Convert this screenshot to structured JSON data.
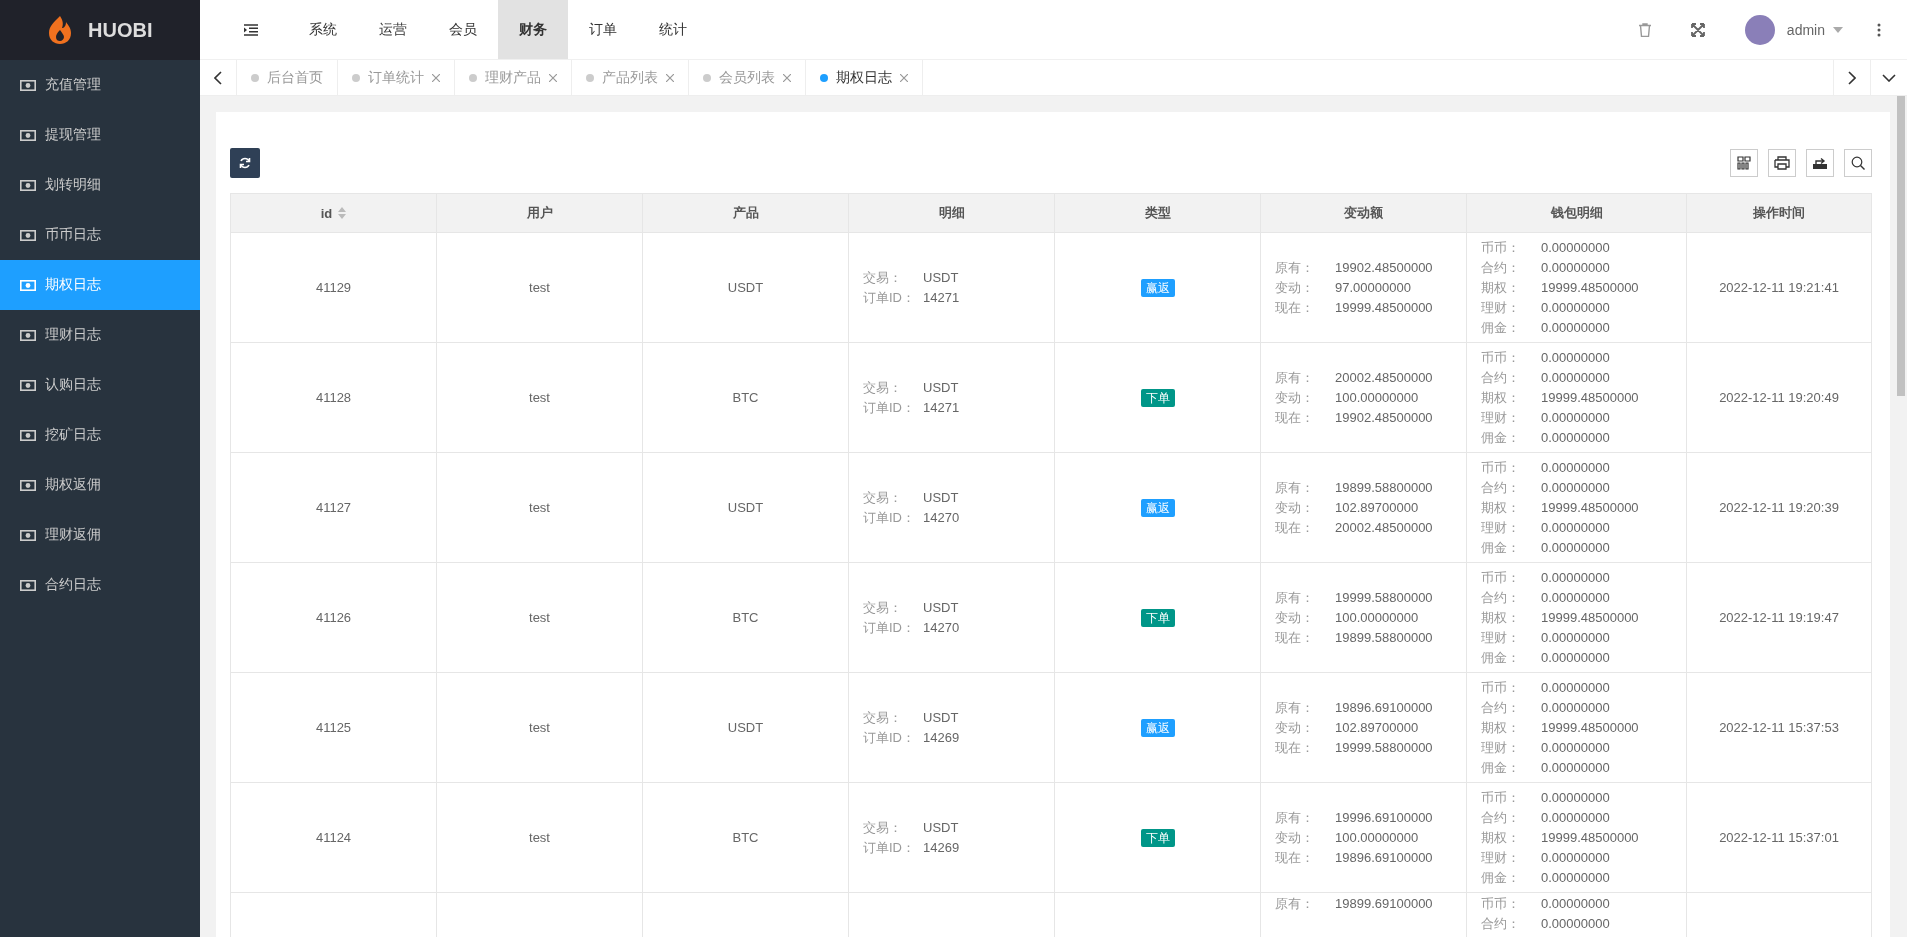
{
  "brand": {
    "name": "HUOBI"
  },
  "sidebar": {
    "items": [
      {
        "label": "充值管理",
        "selected": false
      },
      {
        "label": "提现管理",
        "selected": false
      },
      {
        "label": "划转明细",
        "selected": false
      },
      {
        "label": "币币日志",
        "selected": false
      },
      {
        "label": "期权日志",
        "selected": true
      },
      {
        "label": "理财日志",
        "selected": false
      },
      {
        "label": "认购日志",
        "selected": false
      },
      {
        "label": "挖矿日志",
        "selected": false
      },
      {
        "label": "期权返佣",
        "selected": false
      },
      {
        "label": "理财返佣",
        "selected": false
      },
      {
        "label": "合约日志",
        "selected": false
      }
    ]
  },
  "top_nav": [
    {
      "label": "系统",
      "selected": false
    },
    {
      "label": "运营",
      "selected": false
    },
    {
      "label": "会员",
      "selected": false
    },
    {
      "label": "财务",
      "selected": true
    },
    {
      "label": "订单",
      "selected": false
    },
    {
      "label": "统计",
      "selected": false
    }
  ],
  "user": {
    "name": "admin"
  },
  "tabs": [
    {
      "label": "后台首页",
      "selected": false,
      "closable": false
    },
    {
      "label": "订单统计",
      "selected": false,
      "closable": true
    },
    {
      "label": "理财产品",
      "selected": false,
      "closable": true
    },
    {
      "label": "产品列表",
      "selected": false,
      "closable": true
    },
    {
      "label": "会员列表",
      "selected": false,
      "closable": true
    },
    {
      "label": "期权日志",
      "selected": true,
      "closable": true
    }
  ],
  "table": {
    "columns": [
      {
        "label": "id",
        "sortable": true
      },
      {
        "label": "用户",
        "sortable": false
      },
      {
        "label": "产品",
        "sortable": false
      },
      {
        "label": "明细",
        "sortable": false
      },
      {
        "label": "类型",
        "sortable": false
      },
      {
        "label": "变动额",
        "sortable": false
      },
      {
        "label": "钱包明细",
        "sortable": false
      },
      {
        "label": "操作时间",
        "sortable": false
      }
    ],
    "rows": [
      {
        "id": "41129",
        "user": "test",
        "product": "USDT",
        "detail": [
          {
            "label": "交易：",
            "value": "USDT"
          },
          {
            "label": "订单ID：",
            "value": "14271"
          }
        ],
        "type": {
          "label": "赢返",
          "color": "#1e9fff"
        },
        "change": [
          {
            "label": "原有：",
            "value": "19902.48500000"
          },
          {
            "label": "变动：",
            "value": "97.00000000"
          },
          {
            "label": "现在：",
            "value": "19999.48500000"
          }
        ],
        "wallet": [
          {
            "label": "币币：",
            "value": "0.00000000"
          },
          {
            "label": "合约：",
            "value": "0.00000000"
          },
          {
            "label": "期权：",
            "value": "19999.48500000"
          },
          {
            "label": "理财：",
            "value": "0.00000000"
          },
          {
            "label": "佣金：",
            "value": "0.00000000"
          }
        ],
        "time": "2022-12-11 19:21:41"
      },
      {
        "id": "41128",
        "user": "test",
        "product": "BTC",
        "detail": [
          {
            "label": "交易：",
            "value": "USDT"
          },
          {
            "label": "订单ID：",
            "value": "14271"
          }
        ],
        "type": {
          "label": "下单",
          "color": "#009688"
        },
        "change": [
          {
            "label": "原有：",
            "value": "20002.48500000"
          },
          {
            "label": "变动：",
            "value": "100.00000000"
          },
          {
            "label": "现在：",
            "value": "19902.48500000"
          }
        ],
        "wallet": [
          {
            "label": "币币：",
            "value": "0.00000000"
          },
          {
            "label": "合约：",
            "value": "0.00000000"
          },
          {
            "label": "期权：",
            "value": "19999.48500000"
          },
          {
            "label": "理财：",
            "value": "0.00000000"
          },
          {
            "label": "佣金：",
            "value": "0.00000000"
          }
        ],
        "time": "2022-12-11 19:20:49"
      },
      {
        "id": "41127",
        "user": "test",
        "product": "USDT",
        "detail": [
          {
            "label": "交易：",
            "value": "USDT"
          },
          {
            "label": "订单ID：",
            "value": "14270"
          }
        ],
        "type": {
          "label": "赢返",
          "color": "#1e9fff"
        },
        "change": [
          {
            "label": "原有：",
            "value": "19899.58800000"
          },
          {
            "label": "变动：",
            "value": "102.89700000"
          },
          {
            "label": "现在：",
            "value": "20002.48500000"
          }
        ],
        "wallet": [
          {
            "label": "币币：",
            "value": "0.00000000"
          },
          {
            "label": "合约：",
            "value": "0.00000000"
          },
          {
            "label": "期权：",
            "value": "19999.48500000"
          },
          {
            "label": "理财：",
            "value": "0.00000000"
          },
          {
            "label": "佣金：",
            "value": "0.00000000"
          }
        ],
        "time": "2022-12-11 19:20:39"
      },
      {
        "id": "41126",
        "user": "test",
        "product": "BTC",
        "detail": [
          {
            "label": "交易：",
            "value": "USDT"
          },
          {
            "label": "订单ID：",
            "value": "14270"
          }
        ],
        "type": {
          "label": "下单",
          "color": "#009688"
        },
        "change": [
          {
            "label": "原有：",
            "value": "19999.58800000"
          },
          {
            "label": "变动：",
            "value": "100.00000000"
          },
          {
            "label": "现在：",
            "value": "19899.58800000"
          }
        ],
        "wallet": [
          {
            "label": "币币：",
            "value": "0.00000000"
          },
          {
            "label": "合约：",
            "value": "0.00000000"
          },
          {
            "label": "期权：",
            "value": "19999.48500000"
          },
          {
            "label": "理财：",
            "value": "0.00000000"
          },
          {
            "label": "佣金：",
            "value": "0.00000000"
          }
        ],
        "time": "2022-12-11 19:19:47"
      },
      {
        "id": "41125",
        "user": "test",
        "product": "USDT",
        "detail": [
          {
            "label": "交易：",
            "value": "USDT"
          },
          {
            "label": "订单ID：",
            "value": "14269"
          }
        ],
        "type": {
          "label": "赢返",
          "color": "#1e9fff"
        },
        "change": [
          {
            "label": "原有：",
            "value": "19896.69100000"
          },
          {
            "label": "变动：",
            "value": "102.89700000"
          },
          {
            "label": "现在：",
            "value": "19999.58800000"
          }
        ],
        "wallet": [
          {
            "label": "币币：",
            "value": "0.00000000"
          },
          {
            "label": "合约：",
            "value": "0.00000000"
          },
          {
            "label": "期权：",
            "value": "19999.48500000"
          },
          {
            "label": "理财：",
            "value": "0.00000000"
          },
          {
            "label": "佣金：",
            "value": "0.00000000"
          }
        ],
        "time": "2022-12-11 15:37:53"
      },
      {
        "id": "41124",
        "user": "test",
        "product": "BTC",
        "detail": [
          {
            "label": "交易：",
            "value": "USDT"
          },
          {
            "label": "订单ID：",
            "value": "14269"
          }
        ],
        "type": {
          "label": "下单",
          "color": "#009688"
        },
        "change": [
          {
            "label": "原有：",
            "value": "19996.69100000"
          },
          {
            "label": "变动：",
            "value": "100.00000000"
          },
          {
            "label": "现在：",
            "value": "19896.69100000"
          }
        ],
        "wallet": [
          {
            "label": "币币：",
            "value": "0.00000000"
          },
          {
            "label": "合约：",
            "value": "0.00000000"
          },
          {
            "label": "期权：",
            "value": "19999.48500000"
          },
          {
            "label": "理财：",
            "value": "0.00000000"
          },
          {
            "label": "佣金：",
            "value": "0.00000000"
          }
        ],
        "time": "2022-12-11 15:37:01"
      },
      {
        "change": [
          {
            "label": "原有：",
            "value": "19899.69100000"
          }
        ],
        "wallet": [
          {
            "label": "币币：",
            "value": "0.00000000"
          },
          {
            "label": "合约：",
            "value": "0.00000000"
          }
        ]
      }
    ]
  }
}
